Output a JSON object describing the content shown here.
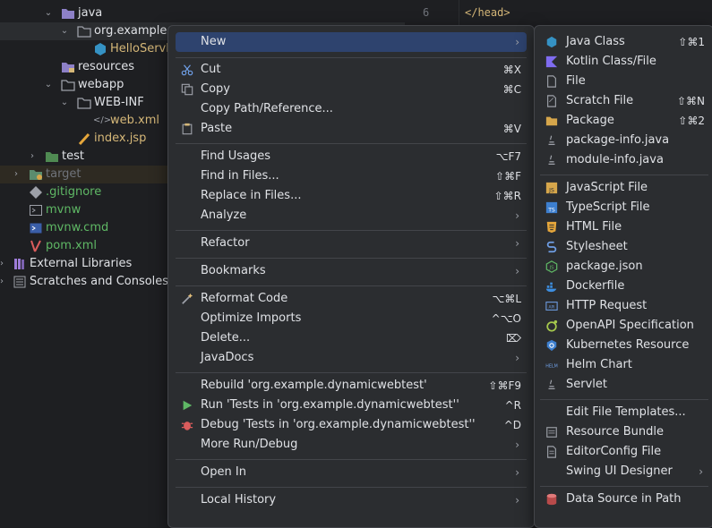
{
  "project_tree": {
    "items": [
      {
        "label": "java",
        "arrow": "⌄"
      },
      {
        "label": "org.example.d",
        "arrow": "⌄"
      },
      {
        "label": "HelloServle"
      },
      {
        "label": "resources"
      },
      {
        "label": "webapp",
        "arrow": "⌄"
      },
      {
        "label": "WEB-INF",
        "arrow": "⌄"
      },
      {
        "label": "web.xml"
      },
      {
        "label": "index.jsp"
      },
      {
        "label": "test",
        "arrow": "›"
      },
      {
        "label": "target",
        "arrow": "›"
      },
      {
        "label": ".gitignore"
      },
      {
        "label": "mvnw"
      },
      {
        "label": "mvnw.cmd"
      },
      {
        "label": "pom.xml"
      },
      {
        "label": "External Libraries",
        "arrow": "›"
      },
      {
        "label": "Scratches and Consoles",
        "arrow": "›"
      }
    ]
  },
  "editor": {
    "line_number": "6",
    "code": "</head>"
  },
  "context_menu": {
    "new": {
      "label": "New",
      "sub": "›"
    },
    "cut": {
      "label": "Cut",
      "sc": "⌘X"
    },
    "copy": {
      "label": "Copy",
      "sc": "⌘C"
    },
    "copy_path": {
      "label": "Copy Path/Reference..."
    },
    "paste": {
      "label": "Paste",
      "sc": "⌘V"
    },
    "find_usages": {
      "label": "Find Usages",
      "sc": "⌥F7"
    },
    "find_in_files": {
      "label": "Find in Files...",
      "sc": "⇧⌘F"
    },
    "replace_in_files": {
      "label": "Replace in Files...",
      "sc": "⇧⌘R"
    },
    "analyze": {
      "label": "Analyze",
      "sub": "›"
    },
    "refactor": {
      "label": "Refactor",
      "sub": "›"
    },
    "bookmarks": {
      "label": "Bookmarks",
      "sub": "›"
    },
    "reformat": {
      "label": "Reformat Code",
      "sc": "⌥⌘L"
    },
    "optimize": {
      "label": "Optimize Imports",
      "sc": "^⌥O"
    },
    "delete": {
      "label": "Delete...",
      "sc": "⌦"
    },
    "javadocs": {
      "label": "JavaDocs",
      "sub": "›"
    },
    "rebuild": {
      "label": "Rebuild 'org.example.dynamicwebtest'",
      "sc": "⇧⌘F9"
    },
    "run_tests": {
      "label": "Run 'Tests in 'org.example.dynamicwebtest''",
      "sc": "^R"
    },
    "debug_tests": {
      "label": "Debug 'Tests in 'org.example.dynamicwebtest''",
      "sc": "^D"
    },
    "more_run": {
      "label": "More Run/Debug",
      "sub": "›"
    },
    "open_in": {
      "label": "Open In",
      "sub": "›"
    },
    "local_history": {
      "label": "Local History",
      "sub": "›"
    }
  },
  "new_submenu": {
    "java_class": {
      "label": "Java Class",
      "sc": "⇧⌘1"
    },
    "kotlin": {
      "label": "Kotlin Class/File"
    },
    "file": {
      "label": "File"
    },
    "scratch": {
      "label": "Scratch File",
      "sc": "⇧⌘N"
    },
    "package": {
      "label": "Package",
      "sc": "⇧⌘2"
    },
    "package_info": {
      "label": "package-info.java"
    },
    "module_info": {
      "label": "module-info.java"
    },
    "js": {
      "label": "JavaScript File"
    },
    "ts": {
      "label": "TypeScript File"
    },
    "html": {
      "label": "HTML File"
    },
    "stylesheet": {
      "label": "Stylesheet"
    },
    "package_json": {
      "label": "package.json"
    },
    "dockerfile": {
      "label": "Dockerfile"
    },
    "http": {
      "label": "HTTP Request"
    },
    "openapi": {
      "label": "OpenAPI Specification"
    },
    "k8s": {
      "label": "Kubernetes Resource"
    },
    "helm": {
      "label": "Helm Chart"
    },
    "servlet": {
      "label": "Servlet"
    },
    "edit_templates": {
      "label": "Edit File Templates..."
    },
    "resource_bundle": {
      "label": "Resource Bundle"
    },
    "editorconfig": {
      "label": "EditorConfig File"
    },
    "swing": {
      "label": "Swing UI Designer",
      "sub": "›"
    },
    "datasource": {
      "label": "Data Source in Path"
    }
  },
  "icons": {
    "folder": "folder-icon",
    "package": "package-folder-icon",
    "java_class": "java-class-icon",
    "cut": "scissors-icon",
    "copy": "copy-icon",
    "paste": "clipboard-icon",
    "reformat": "magic-wand-icon",
    "run": "run-triangle-icon",
    "debug": "bug-icon"
  },
  "colors": {
    "background": "#1e1f22",
    "menu_background": "#2b2d30",
    "highlight": "#2e436e",
    "text": "#dfe1e5",
    "resource_file": "#d5b778",
    "excluded_text": "#6f737a",
    "run_green": "#5fb865",
    "debug_red": "#db5c5c",
    "java_blue": "#3592c4"
  }
}
